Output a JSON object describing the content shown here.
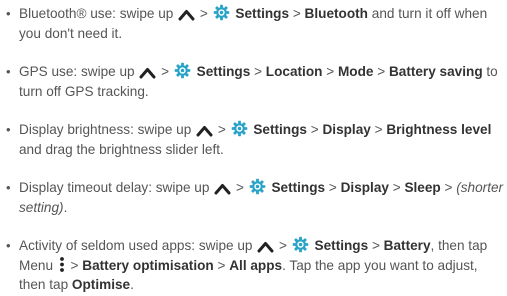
{
  "bullet_glyph": "•",
  "colors": {
    "text": "#555555",
    "bold_text": "#333333",
    "settings_icon_fill": "#2aa3c9",
    "settings_icon_bg": "#ffffff",
    "chevron": "#222222"
  },
  "icons": {
    "swipe_up": "chevron-up-icon",
    "settings": "settings-gear-icon",
    "menu": "vertical-dots-menu-icon"
  },
  "tips": [
    {
      "id": "bluetooth",
      "segments": [
        {
          "t": "text",
          "v": "Bluetooth® use: swipe up "
        },
        {
          "t": "chevron"
        },
        {
          "t": "text",
          "v": " > "
        },
        {
          "t": "gear"
        },
        {
          "t": "bold",
          "v": " Settings"
        },
        {
          "t": "text",
          "v": " > "
        },
        {
          "t": "bold",
          "v": "Bluetooth"
        },
        {
          "t": "text",
          "v": " and turn it off when you don't need it."
        }
      ]
    },
    {
      "id": "gps",
      "segments": [
        {
          "t": "text",
          "v": "GPS use: swipe up "
        },
        {
          "t": "chevron"
        },
        {
          "t": "text",
          "v": " > "
        },
        {
          "t": "gear"
        },
        {
          "t": "bold",
          "v": " Settings"
        },
        {
          "t": "text",
          "v": " > "
        },
        {
          "t": "bold",
          "v": "Location"
        },
        {
          "t": "text",
          "v": " > "
        },
        {
          "t": "bold",
          "v": "Mode"
        },
        {
          "t": "text",
          "v": " > "
        },
        {
          "t": "bold",
          "v": "Battery saving"
        },
        {
          "t": "text",
          "v": " to turn off GPS tracking."
        }
      ]
    },
    {
      "id": "brightness",
      "segments": [
        {
          "t": "text",
          "v": "Display brightness: swipe up "
        },
        {
          "t": "chevron"
        },
        {
          "t": "text",
          "v": " > "
        },
        {
          "t": "gear"
        },
        {
          "t": "bold",
          "v": " Settings"
        },
        {
          "t": "text",
          "v": " > "
        },
        {
          "t": "bold",
          "v": "Display"
        },
        {
          "t": "text",
          "v": " > "
        },
        {
          "t": "bold",
          "v": "Brightness level"
        },
        {
          "t": "text",
          "v": " and drag the brightness slider left."
        }
      ]
    },
    {
      "id": "timeout",
      "segments": [
        {
          "t": "text",
          "v": "Display timeout delay: swipe up "
        },
        {
          "t": "chevron"
        },
        {
          "t": "text",
          "v": " > "
        },
        {
          "t": "gear"
        },
        {
          "t": "bold",
          "v": " Settings"
        },
        {
          "t": "text",
          "v": " > "
        },
        {
          "t": "bold",
          "v": "Display"
        },
        {
          "t": "text",
          "v": " > "
        },
        {
          "t": "bold",
          "v": "Sleep"
        },
        {
          "t": "text",
          "v": " > "
        },
        {
          "t": "italic",
          "v": "(shorter setting)"
        },
        {
          "t": "text",
          "v": "."
        }
      ]
    },
    {
      "id": "apps",
      "segments": [
        {
          "t": "text",
          "v": "Activity of seldom used apps: swipe up "
        },
        {
          "t": "chevron"
        },
        {
          "t": "text",
          "v": " > "
        },
        {
          "t": "gear"
        },
        {
          "t": "bold",
          "v": " Settings"
        },
        {
          "t": "text",
          "v": " > "
        },
        {
          "t": "bold",
          "v": "Battery"
        },
        {
          "t": "text",
          "v": ", then tap Menu "
        },
        {
          "t": "menu"
        },
        {
          "t": "text",
          "v": " > "
        },
        {
          "t": "bold",
          "v": "Battery optimisation"
        },
        {
          "t": "text",
          "v": " > "
        },
        {
          "t": "bold",
          "v": "All apps"
        },
        {
          "t": "text",
          "v": ". Tap the app you want to adjust, then tap "
        },
        {
          "t": "bold",
          "v": "Optimise"
        },
        {
          "t": "text",
          "v": "."
        }
      ]
    }
  ]
}
